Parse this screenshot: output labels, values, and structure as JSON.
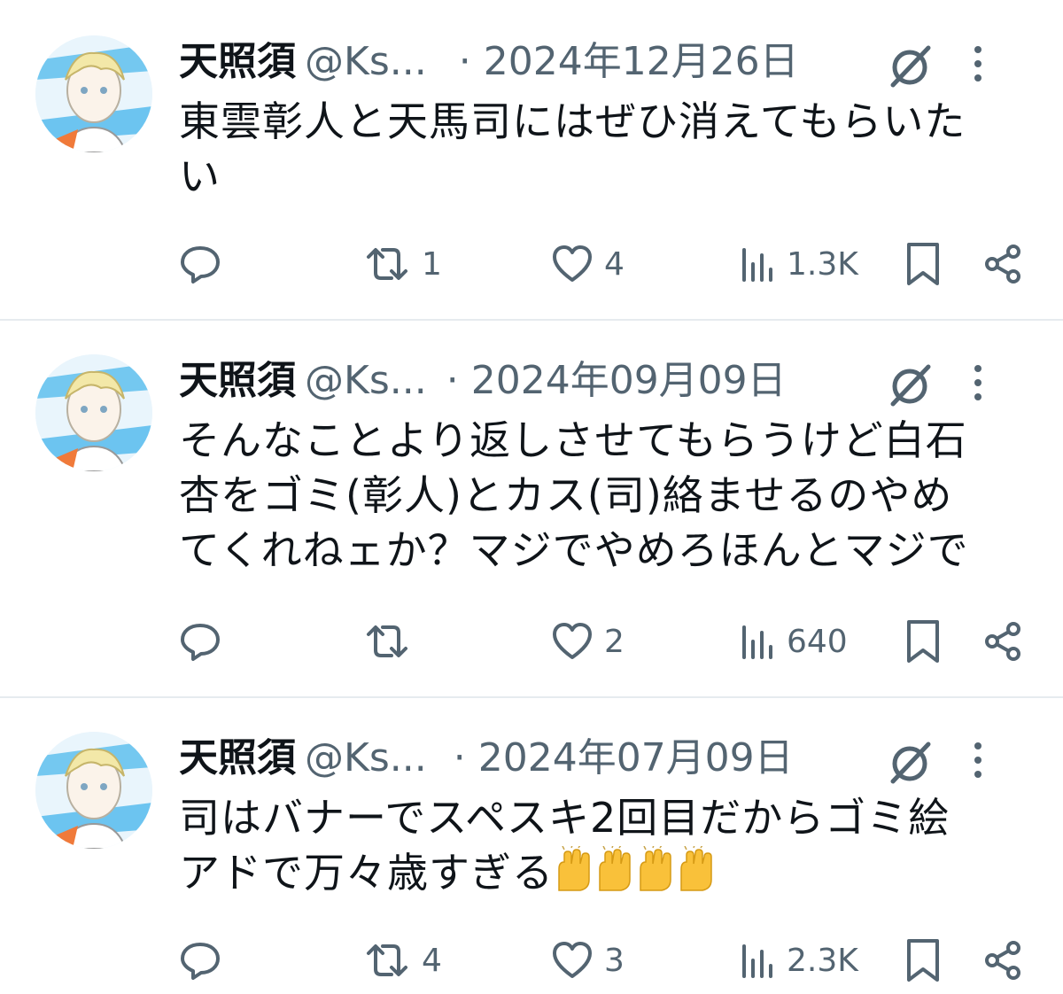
{
  "tweets": [
    {
      "author_name": "天照須",
      "handle": "@Ks...",
      "date": "· 2024年12月26日",
      "text_lines": [
        "東雲彰人と天馬司にはぜひ消えてもらいた",
        "い"
      ],
      "text_emoji": "",
      "replies": "",
      "retweets": "1",
      "likes": "4",
      "views": "1.3K"
    },
    {
      "author_name": "天照須",
      "handle": "@Ks...",
      "date": "· 2024年09月09日",
      "text_lines": [
        "そんなことより返しさせてもらうけど白石",
        "杏をゴミ(彰人)とカス(司)絡ませるのやめ",
        "てくれねェか？マジでやめろほんとマジで"
      ],
      "text_emoji": "",
      "replies": "",
      "retweets": "",
      "likes": "2",
      "views": "640"
    },
    {
      "author_name": "天照須",
      "handle": "@Ks...",
      "date": "· 2024年07月09日",
      "text_lines": [
        "司はバナーでスペスキ2回目だからゴミ絵",
        "アドで万々歳すぎる"
      ],
      "text_emoji": "raising-hands-emoji x4",
      "replies": "",
      "retweets": "4",
      "likes": "3",
      "views": "2.3K"
    }
  ],
  "icons": {
    "avatar": "avatar-image",
    "grok": "grok-icon",
    "more": "more-vertical-icon",
    "reply": "reply-icon",
    "retweet": "retweet-icon",
    "like": "heart-icon",
    "views": "analytics-icon",
    "bookmark": "bookmark-icon",
    "share": "share-icon"
  },
  "colors": {
    "text": "#0f1419",
    "secondary": "#536471",
    "divider": "#e6ebef"
  }
}
